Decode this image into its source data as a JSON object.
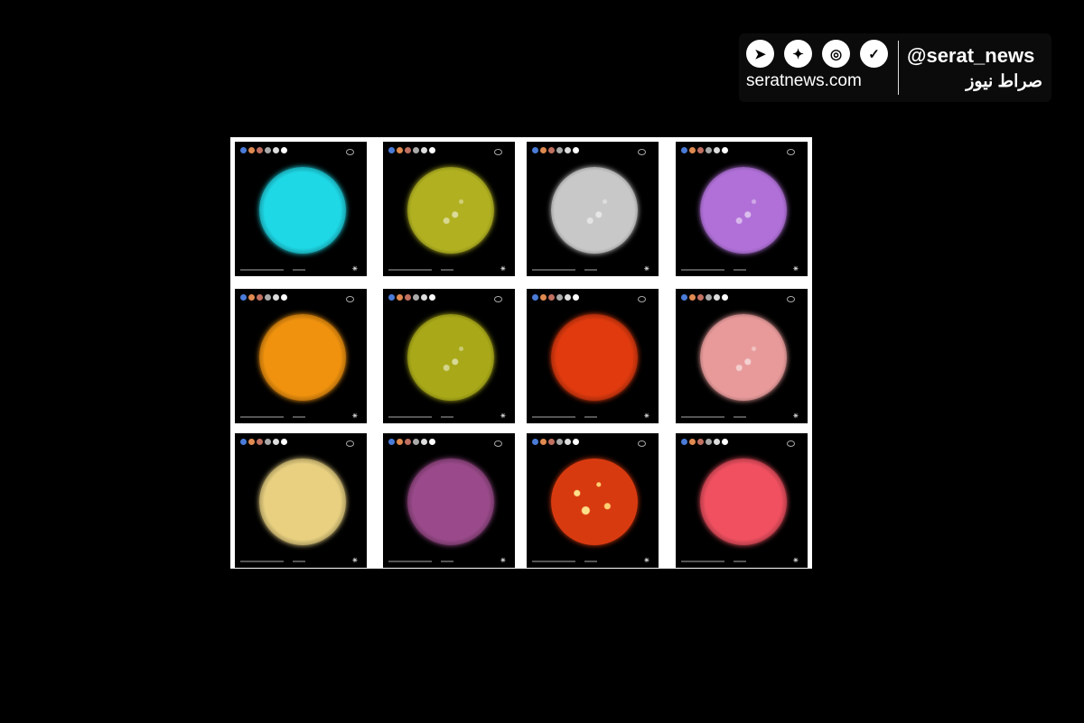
{
  "watermark": {
    "handle": "@serat_news",
    "site": "seratnews.com",
    "brand": "صراط نیوز",
    "icons": [
      "telegram-icon",
      "twitter-icon",
      "instagram-icon",
      "shield-check-icon"
    ]
  },
  "grid": {
    "background": "#ffffff",
    "panels": [
      {
        "color": "#1ed8e6",
        "texture": "smooth"
      },
      {
        "color": "#b0b020",
        "texture": "spotted"
      },
      {
        "color": "#c8c8c8",
        "texture": "spotted"
      },
      {
        "color": "#b070d8",
        "texture": "spotted"
      },
      {
        "color": "#f0920e",
        "texture": "smooth"
      },
      {
        "color": "#a8a818",
        "texture": "spotted"
      },
      {
        "color": "#e03a0e",
        "texture": "smooth"
      },
      {
        "color": "#e89a9a",
        "texture": "spotted"
      },
      {
        "color": "#e8d080",
        "texture": "smooth"
      },
      {
        "color": "#9a4a8a",
        "texture": "smooth"
      },
      {
        "color": "#d83a10",
        "texture": "flares"
      },
      {
        "color": "#f05060",
        "texture": "smooth"
      }
    ]
  }
}
